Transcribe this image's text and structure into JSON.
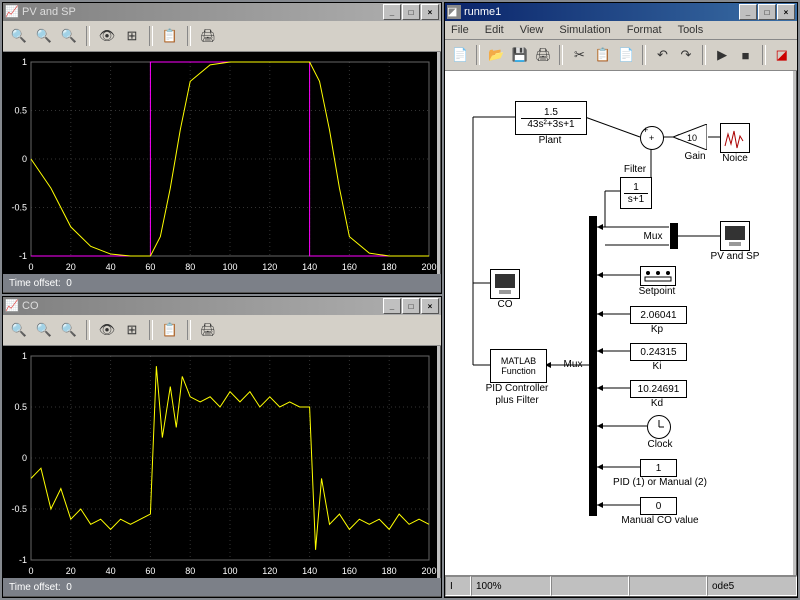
{
  "windows": {
    "pv_sp": {
      "title": "PV and SP",
      "time_offset_label": "Time offset:",
      "time_offset_value": "0"
    },
    "co": {
      "title": "CO",
      "time_offset_label": "Time offset:",
      "time_offset_value": "0"
    },
    "model": {
      "title": "runme1",
      "menu": {
        "file": "File",
        "edit": "Edit",
        "view": "View",
        "simulation": "Simulation",
        "format": "Format",
        "tools": "Tools"
      },
      "status": {
        "pct": "100%",
        "solver": "ode5",
        "ready": "I"
      }
    }
  },
  "toolbar": {
    "zoom_in": "🔍",
    "zoom_x": "🔍",
    "zoom_y": "🔍",
    "binoc": "👁",
    "autoscale": "⊞",
    "save": "💾",
    "print": "🖨",
    "new": "📄",
    "open": "📂",
    "save2": "💾",
    "print2": "🖨",
    "cut": "✂",
    "copy": "📋",
    "paste": "📄",
    "undo": "↶",
    "redo": "↷",
    "play": "▶",
    "stop": "■",
    "lib": "🔧"
  },
  "blocks": {
    "plant": {
      "num": "1.5",
      "den": "43s²+3s+1",
      "label": "Plant"
    },
    "gain": {
      "value": "10",
      "label": "Gain"
    },
    "noise": {
      "label": "Noice"
    },
    "filter": {
      "title": "Filter",
      "num": "1",
      "den": "s+1"
    },
    "mux": {
      "label": "Mux"
    },
    "scope_pv": {
      "label": "PV and SP"
    },
    "setpoint": {
      "label": "Setpoint"
    },
    "kp": {
      "value": "2.06041",
      "label": "Kp"
    },
    "ki": {
      "value": "0.24315",
      "label": "Ki"
    },
    "kd": {
      "value": "10.24691",
      "label": "Kd"
    },
    "clock": {
      "label": "Clock"
    },
    "pid_manual": {
      "value": "1",
      "label": "PID (1) or Manual (2)"
    },
    "manual_co": {
      "value": "0",
      "label": "Manual CO value"
    },
    "matlab_fcn": {
      "l1": "MATLAB",
      "l2": "Function",
      "label_l1": "PID Controller",
      "label_l2": "plus Filter"
    },
    "scope_co": {
      "label": "CO"
    },
    "mux_big": {
      "label": "Mux"
    }
  },
  "chart_data": [
    {
      "type": "line",
      "title": "PV and SP",
      "xlabel": "",
      "ylabel": "",
      "xlim": [
        0,
        200
      ],
      "ylim": [
        -1,
        1
      ],
      "xticks": [
        0,
        20,
        40,
        60,
        80,
        100,
        120,
        140,
        160,
        180,
        200
      ],
      "yticks": [
        -1,
        -0.5,
        0,
        0.5,
        1
      ],
      "series": [
        {
          "name": "SP",
          "color": "#ff00ff",
          "x": [
            0,
            60,
            60,
            140,
            140,
            200
          ],
          "y": [
            -1,
            -1,
            1,
            1,
            -1,
            -1
          ]
        },
        {
          "name": "PV",
          "color": "#ffff00",
          "x": [
            0,
            10,
            20,
            30,
            40,
            50,
            60,
            65,
            70,
            75,
            80,
            90,
            100,
            120,
            140,
            145,
            150,
            155,
            160,
            170,
            180,
            200
          ],
          "y": [
            0,
            -0.3,
            -0.7,
            -0.9,
            -0.98,
            -1,
            -1,
            -0.8,
            -0.3,
            0.3,
            0.8,
            0.97,
            1,
            1,
            1,
            0.8,
            0.3,
            -0.3,
            -0.8,
            -0.97,
            -1,
            -1
          ]
        }
      ]
    },
    {
      "type": "line",
      "title": "CO",
      "xlabel": "",
      "ylabel": "",
      "xlim": [
        0,
        200
      ],
      "ylim": [
        -1,
        1
      ],
      "xticks": [
        0,
        20,
        40,
        60,
        80,
        100,
        120,
        140,
        160,
        180,
        200
      ],
      "yticks": [
        -1,
        -0.5,
        0,
        0.5,
        1
      ],
      "series": [
        {
          "name": "CO",
          "color": "#ffff00",
          "x": [
            0,
            5,
            10,
            15,
            20,
            25,
            30,
            35,
            40,
            45,
            50,
            55,
            60,
            63,
            66,
            70,
            73,
            76,
            80,
            85,
            90,
            95,
            100,
            105,
            110,
            115,
            120,
            125,
            130,
            135,
            140,
            143,
            146,
            150,
            155,
            160,
            165,
            170,
            175,
            180,
            185,
            190,
            195,
            200
          ],
          "y": [
            -0.2,
            -0.1,
            -0.5,
            -0.3,
            -0.6,
            -0.5,
            -0.65,
            -0.6,
            -0.7,
            -0.6,
            -0.65,
            -0.6,
            -0.55,
            0.9,
            0.2,
            0.7,
            0.3,
            0.8,
            0.6,
            0.55,
            0.6,
            0.5,
            0.65,
            0.55,
            0.65,
            0.5,
            0.6,
            0.5,
            0.55,
            0.5,
            0.5,
            -0.9,
            -0.2,
            -0.65,
            -0.55,
            -0.7,
            -0.6,
            -0.65,
            -0.6,
            -0.7,
            -0.55,
            -0.65,
            -0.6,
            -0.65
          ]
        }
      ]
    }
  ]
}
